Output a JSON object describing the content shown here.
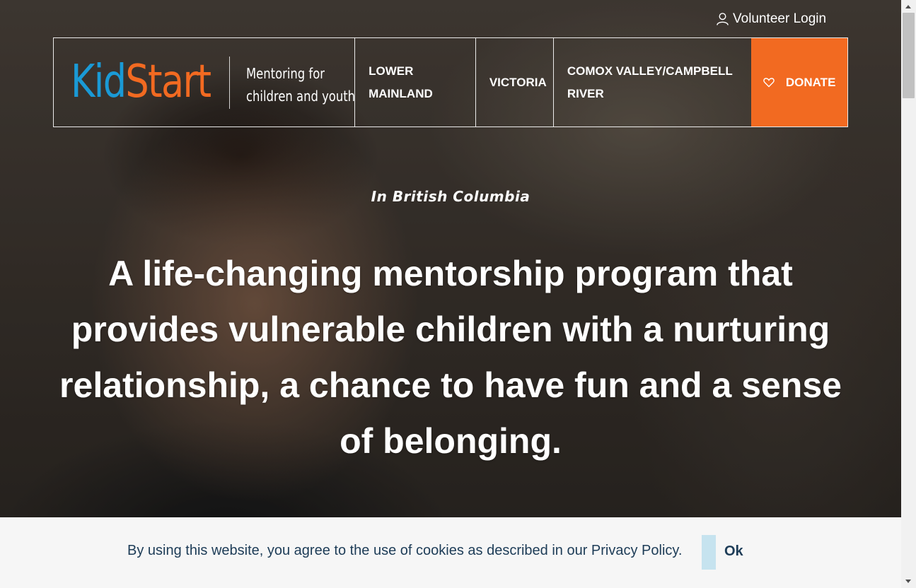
{
  "header": {
    "volunteer_login": "Volunteer Login",
    "icons": {
      "login": "user-icon",
      "donate": "heart-icon"
    }
  },
  "logo": {
    "kid": "Kid",
    "start": "Start",
    "tagline_line1": "Mentoring for",
    "tagline_line2": "children and youth",
    "colors": {
      "kid": "#1a9ad6",
      "start": "#f26a21"
    }
  },
  "nav": {
    "items": [
      {
        "line1": "LOWER",
        "line2": "MAINLAND"
      },
      {
        "line1": "VICTORIA"
      },
      {
        "line1": "COMOX VALLEY/CAMPBELL",
        "line2": "RIVER"
      }
    ],
    "donate_label": "DONATE",
    "donate_color": "#f26a21"
  },
  "hero": {
    "kicker": "In British Columbia",
    "headline": "A life-changing mentorship program that provides vulnerable children with a nurturing relationship, a chance to have fun and a sense of belonging."
  },
  "cookie": {
    "text": "By using this website, you agree to the use of cookies as described in our Privacy Policy.",
    "ok_label": "Ok",
    "accent_color": "#c6e3ef",
    "text_color": "#1d3c57"
  }
}
